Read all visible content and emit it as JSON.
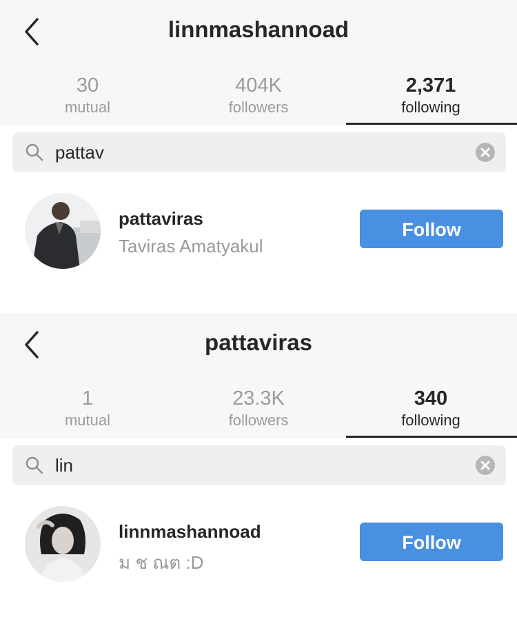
{
  "panels": [
    {
      "header": {
        "title": "linnmashannoad",
        "tabs": [
          {
            "count": "30",
            "label": "mutual"
          },
          {
            "count": "404K",
            "label": "followers"
          },
          {
            "count": "2,371",
            "label": "following"
          }
        ],
        "active_tab": "following"
      },
      "search": {
        "query": "pattav"
      },
      "result": {
        "username": "pattaviras",
        "full_name": "Taviras Amatyakul",
        "follow_label": "Follow"
      }
    },
    {
      "header": {
        "title": "pattaviras",
        "tabs": [
          {
            "count": "1",
            "label": "mutual"
          },
          {
            "count": "23.3K",
            "label": "followers"
          },
          {
            "count": "340",
            "label": "following"
          }
        ],
        "active_tab": "following"
      },
      "search": {
        "query": "lin"
      },
      "result": {
        "username": "linnmashannoad",
        "full_name": "ม ช ณต :D",
        "follow_label": "Follow"
      }
    }
  ],
  "icons": {
    "back": "chevron-left-icon",
    "search": "search-icon",
    "clear": "clear-x-icon"
  },
  "colors": {
    "follow_button": "#4a90e2",
    "header_bg": "#f7f7f7",
    "search_bg": "#efefef",
    "muted_text": "#9b9b9b",
    "primary_text": "#262626"
  }
}
